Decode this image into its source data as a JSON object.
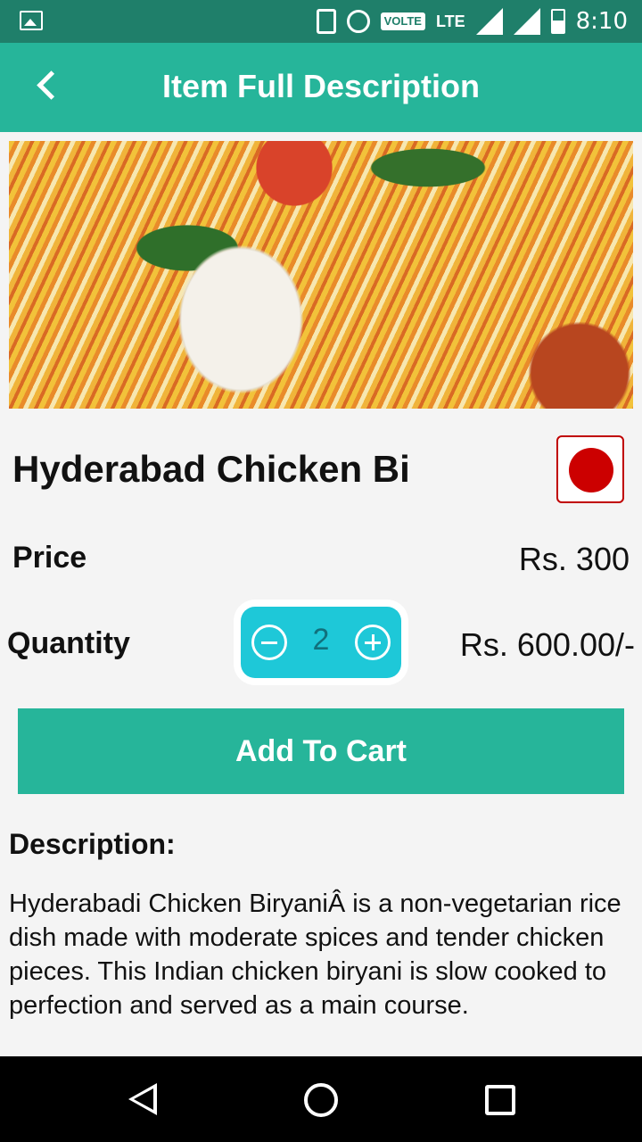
{
  "status_bar": {
    "network_badge": "VOLTE",
    "network_type": "LTE",
    "time": "8:10"
  },
  "app_bar": {
    "title": "Item Full Description"
  },
  "item": {
    "name": "Hyderabad Chicken Bi",
    "price_label": "Price",
    "price": "Rs. 300",
    "quantity_label": "Quantity",
    "quantity": "2",
    "total": "Rs. 600.00/-",
    "food_type": "non-veg",
    "food_type_color": "#cc0000"
  },
  "actions": {
    "add_to_cart_label": "Add To Cart"
  },
  "description": {
    "heading": "Description:",
    "text": "Hyderabadi Chicken BiryaniÂ is a non-vegetarian rice dish made with moderate spices and tender chicken pieces. This Indian chicken biryani is slow cooked to perfection and served as a main course."
  },
  "colors": {
    "accent": "#26b59a",
    "status_bar": "#1f7f6a",
    "quantity_control": "#1ec8d8"
  }
}
